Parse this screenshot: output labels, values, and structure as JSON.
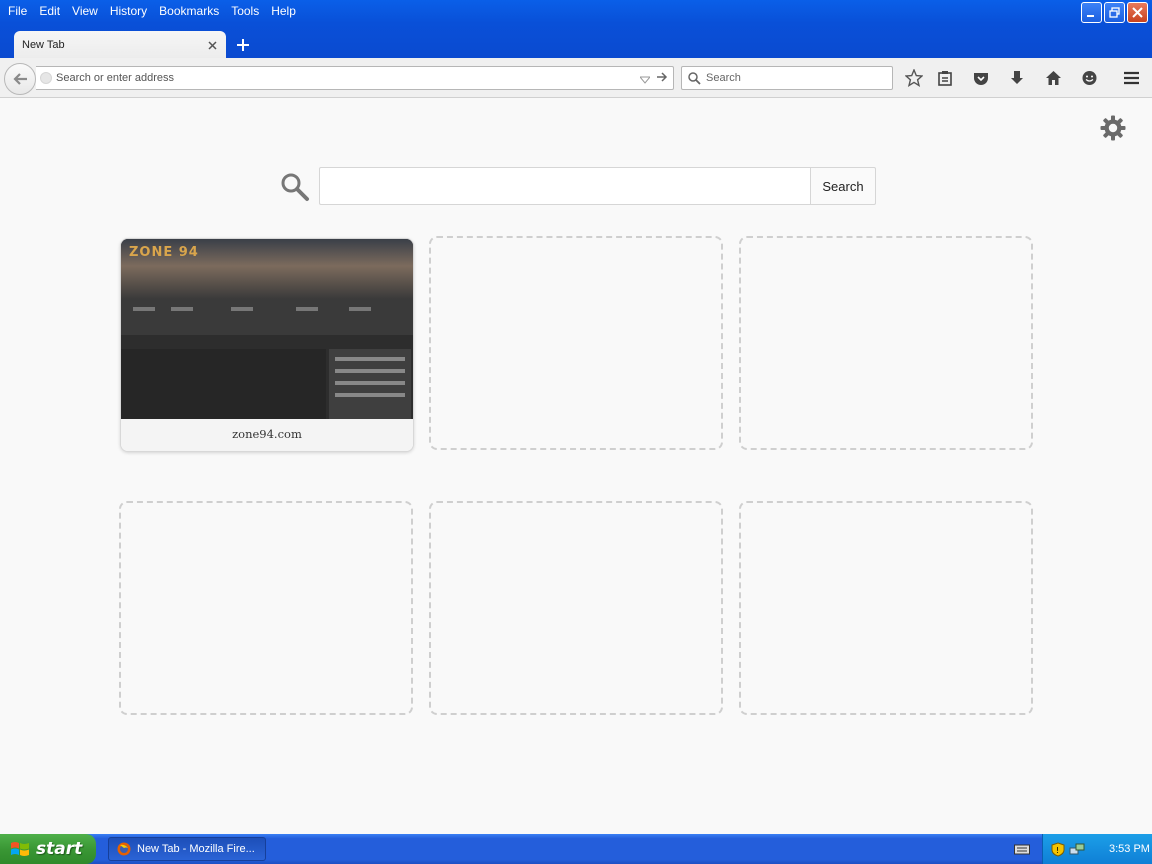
{
  "window": {
    "menu": [
      "File",
      "Edit",
      "View",
      "History",
      "Bookmarks",
      "Tools",
      "Help"
    ]
  },
  "tabs": [
    {
      "label": "New Tab",
      "active": true
    }
  ],
  "navbar": {
    "url_placeholder": "Search or enter address",
    "search_placeholder": "Search"
  },
  "newtab": {
    "search_button": "Search",
    "tiles": [
      {
        "label": "zone94.com",
        "thumb_logo": "ZONE 94"
      },
      {
        "label": ""
      },
      {
        "label": ""
      },
      {
        "label": ""
      },
      {
        "label": ""
      },
      {
        "label": ""
      }
    ]
  },
  "taskbar": {
    "start_label": "start",
    "task_label": "New Tab - Mozilla Fire...",
    "clock": "3:53 PM"
  },
  "colors": {
    "titlebar": "#0b55dc",
    "taskbar": "#245edb",
    "start": "#3a9735"
  }
}
